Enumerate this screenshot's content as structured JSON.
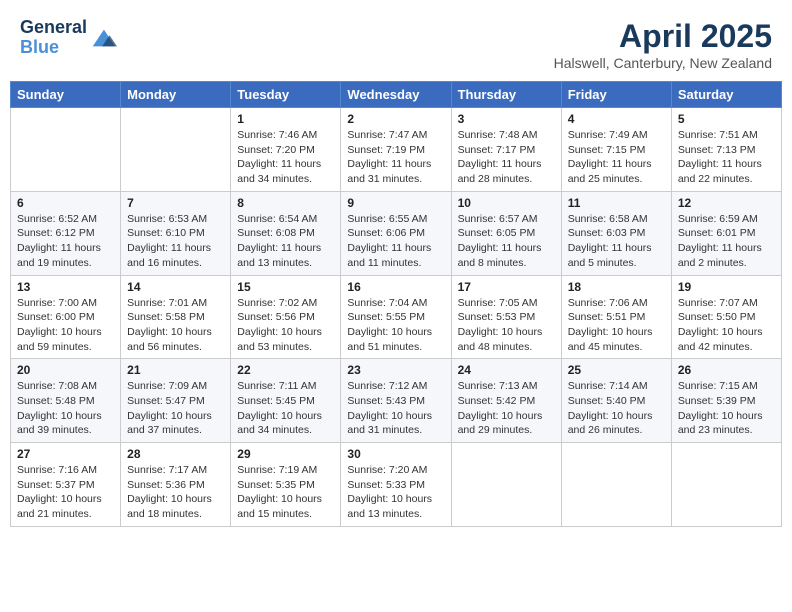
{
  "header": {
    "logo_line1": "General",
    "logo_line2": "Blue",
    "main_title": "April 2025",
    "subtitle": "Halswell, Canterbury, New Zealand"
  },
  "weekdays": [
    "Sunday",
    "Monday",
    "Tuesday",
    "Wednesday",
    "Thursday",
    "Friday",
    "Saturday"
  ],
  "weeks": [
    [
      {
        "day": "",
        "sunrise": "",
        "sunset": "",
        "daylight": ""
      },
      {
        "day": "",
        "sunrise": "",
        "sunset": "",
        "daylight": ""
      },
      {
        "day": "1",
        "sunrise": "Sunrise: 7:46 AM",
        "sunset": "Sunset: 7:20 PM",
        "daylight": "Daylight: 11 hours and 34 minutes."
      },
      {
        "day": "2",
        "sunrise": "Sunrise: 7:47 AM",
        "sunset": "Sunset: 7:19 PM",
        "daylight": "Daylight: 11 hours and 31 minutes."
      },
      {
        "day": "3",
        "sunrise": "Sunrise: 7:48 AM",
        "sunset": "Sunset: 7:17 PM",
        "daylight": "Daylight: 11 hours and 28 minutes."
      },
      {
        "day": "4",
        "sunrise": "Sunrise: 7:49 AM",
        "sunset": "Sunset: 7:15 PM",
        "daylight": "Daylight: 11 hours and 25 minutes."
      },
      {
        "day": "5",
        "sunrise": "Sunrise: 7:51 AM",
        "sunset": "Sunset: 7:13 PM",
        "daylight": "Daylight: 11 hours and 22 minutes."
      }
    ],
    [
      {
        "day": "6",
        "sunrise": "Sunrise: 6:52 AM",
        "sunset": "Sunset: 6:12 PM",
        "daylight": "Daylight: 11 hours and 19 minutes."
      },
      {
        "day": "7",
        "sunrise": "Sunrise: 6:53 AM",
        "sunset": "Sunset: 6:10 PM",
        "daylight": "Daylight: 11 hours and 16 minutes."
      },
      {
        "day": "8",
        "sunrise": "Sunrise: 6:54 AM",
        "sunset": "Sunset: 6:08 PM",
        "daylight": "Daylight: 11 hours and 13 minutes."
      },
      {
        "day": "9",
        "sunrise": "Sunrise: 6:55 AM",
        "sunset": "Sunset: 6:06 PM",
        "daylight": "Daylight: 11 hours and 11 minutes."
      },
      {
        "day": "10",
        "sunrise": "Sunrise: 6:57 AM",
        "sunset": "Sunset: 6:05 PM",
        "daylight": "Daylight: 11 hours and 8 minutes."
      },
      {
        "day": "11",
        "sunrise": "Sunrise: 6:58 AM",
        "sunset": "Sunset: 6:03 PM",
        "daylight": "Daylight: 11 hours and 5 minutes."
      },
      {
        "day": "12",
        "sunrise": "Sunrise: 6:59 AM",
        "sunset": "Sunset: 6:01 PM",
        "daylight": "Daylight: 11 hours and 2 minutes."
      }
    ],
    [
      {
        "day": "13",
        "sunrise": "Sunrise: 7:00 AM",
        "sunset": "Sunset: 6:00 PM",
        "daylight": "Daylight: 10 hours and 59 minutes."
      },
      {
        "day": "14",
        "sunrise": "Sunrise: 7:01 AM",
        "sunset": "Sunset: 5:58 PM",
        "daylight": "Daylight: 10 hours and 56 minutes."
      },
      {
        "day": "15",
        "sunrise": "Sunrise: 7:02 AM",
        "sunset": "Sunset: 5:56 PM",
        "daylight": "Daylight: 10 hours and 53 minutes."
      },
      {
        "day": "16",
        "sunrise": "Sunrise: 7:04 AM",
        "sunset": "Sunset: 5:55 PM",
        "daylight": "Daylight: 10 hours and 51 minutes."
      },
      {
        "day": "17",
        "sunrise": "Sunrise: 7:05 AM",
        "sunset": "Sunset: 5:53 PM",
        "daylight": "Daylight: 10 hours and 48 minutes."
      },
      {
        "day": "18",
        "sunrise": "Sunrise: 7:06 AM",
        "sunset": "Sunset: 5:51 PM",
        "daylight": "Daylight: 10 hours and 45 minutes."
      },
      {
        "day": "19",
        "sunrise": "Sunrise: 7:07 AM",
        "sunset": "Sunset: 5:50 PM",
        "daylight": "Daylight: 10 hours and 42 minutes."
      }
    ],
    [
      {
        "day": "20",
        "sunrise": "Sunrise: 7:08 AM",
        "sunset": "Sunset: 5:48 PM",
        "daylight": "Daylight: 10 hours and 39 minutes."
      },
      {
        "day": "21",
        "sunrise": "Sunrise: 7:09 AM",
        "sunset": "Sunset: 5:47 PM",
        "daylight": "Daylight: 10 hours and 37 minutes."
      },
      {
        "day": "22",
        "sunrise": "Sunrise: 7:11 AM",
        "sunset": "Sunset: 5:45 PM",
        "daylight": "Daylight: 10 hours and 34 minutes."
      },
      {
        "day": "23",
        "sunrise": "Sunrise: 7:12 AM",
        "sunset": "Sunset: 5:43 PM",
        "daylight": "Daylight: 10 hours and 31 minutes."
      },
      {
        "day": "24",
        "sunrise": "Sunrise: 7:13 AM",
        "sunset": "Sunset: 5:42 PM",
        "daylight": "Daylight: 10 hours and 29 minutes."
      },
      {
        "day": "25",
        "sunrise": "Sunrise: 7:14 AM",
        "sunset": "Sunset: 5:40 PM",
        "daylight": "Daylight: 10 hours and 26 minutes."
      },
      {
        "day": "26",
        "sunrise": "Sunrise: 7:15 AM",
        "sunset": "Sunset: 5:39 PM",
        "daylight": "Daylight: 10 hours and 23 minutes."
      }
    ],
    [
      {
        "day": "27",
        "sunrise": "Sunrise: 7:16 AM",
        "sunset": "Sunset: 5:37 PM",
        "daylight": "Daylight: 10 hours and 21 minutes."
      },
      {
        "day": "28",
        "sunrise": "Sunrise: 7:17 AM",
        "sunset": "Sunset: 5:36 PM",
        "daylight": "Daylight: 10 hours and 18 minutes."
      },
      {
        "day": "29",
        "sunrise": "Sunrise: 7:19 AM",
        "sunset": "Sunset: 5:35 PM",
        "daylight": "Daylight: 10 hours and 15 minutes."
      },
      {
        "day": "30",
        "sunrise": "Sunrise: 7:20 AM",
        "sunset": "Sunset: 5:33 PM",
        "daylight": "Daylight: 10 hours and 13 minutes."
      },
      {
        "day": "",
        "sunrise": "",
        "sunset": "",
        "daylight": ""
      },
      {
        "day": "",
        "sunrise": "",
        "sunset": "",
        "daylight": ""
      },
      {
        "day": "",
        "sunrise": "",
        "sunset": "",
        "daylight": ""
      }
    ]
  ]
}
